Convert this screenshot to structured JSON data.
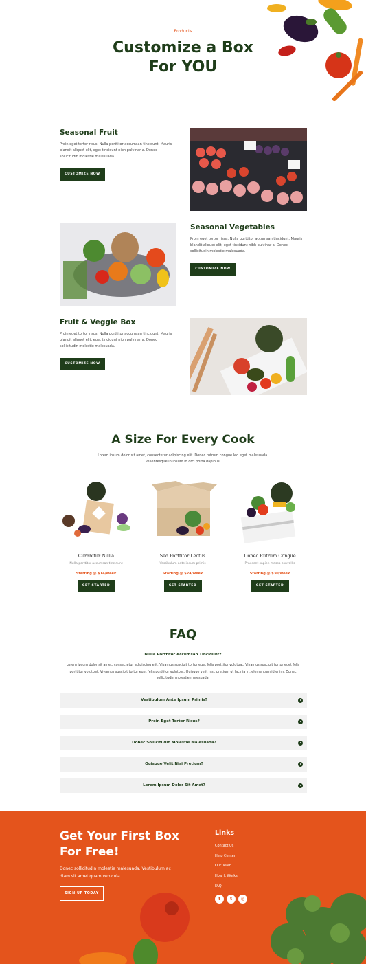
{
  "hero": {
    "eyebrow": "Products",
    "title": "Customize a Box For YOU"
  },
  "features": [
    {
      "title": "Seasonal Fruit",
      "body": "Proin eget tortor risus. Nulla porttitor accumsan tincidunt. Mauris blandit aliquet elit, eget tincidunt nibh pulvinar a. Donec sollicitudin molestie malesuada.",
      "button": "CUSTOMIZE NOW"
    },
    {
      "title": "Seasonal Vegetables",
      "body": "Proin eget tortor risus. Nulla porttitor accumsan tincidunt. Mauris blandit aliquet elit, eget tincidunt nibh pulvinar a. Donec sollicitudin molestie malesuada.",
      "button": "CUSTOMIZE NOW"
    },
    {
      "title": "Fruit & Veggie Box",
      "body": "Proin eget tortor risus. Nulla porttitor accumsan tincidunt. Mauris blandit aliquet elit, eget tincidunt nibh pulvinar a. Donec sollicitudin molestie malesuada.",
      "button": "CUSTOMIZE NOW"
    }
  ],
  "sizes": {
    "title": "A Size For Every Cook",
    "description": "Lorem ipsum dolor sit amet, consectetur adipiscing elit. Donec rutrum congue leo eget malesuada. Pellentesque in ipsum id orci porta dapibus.",
    "cards": [
      {
        "title": "Curabitur Nulla",
        "subtitle": "Nulla porttitor accumsan tincidunt",
        "price": "Starting @ $14/week",
        "button": "GET STARTED"
      },
      {
        "title": "Sed Porttitor Lectus",
        "subtitle": "Vestibulum ante ipsum primis",
        "price": "Starting @ $24/week",
        "button": "GET STARTED"
      },
      {
        "title": "Donec Rutrum Congue",
        "subtitle": "Praesent sapien massa convallis",
        "price": "Starting @ $30/week",
        "button": "GET STARTED"
      }
    ]
  },
  "faq": {
    "title": "FAQ",
    "open_question": "Nulla Porttitor Accumsan Tincidunt?",
    "open_answer": "Lorem ipsum dolor sit amet, consectetur adipiscing elit. Vivamus suscipit tortor eget felis porttitor volutpat. Vivamus suscipit tortor eget felis porttitor volutpat. Vivamus suscipit tortor eget felis porttitor volutpat. Quisque velit nisi, pretium ut lacinia in, elementum id enim. Donec sollicitudin molestie malesuada.",
    "items": [
      "Vestibulum Ante Ipsum Primis?",
      "Proin Eget Tortor Risus?",
      "Donec Sollicitudin Molestie Malesuada?",
      "Quisque Velit Nisi Pretium?",
      "Lorem Ipsum Dolor Sit Amet?"
    ]
  },
  "footer": {
    "title": "Get Your First Box For Free!",
    "text": "Donec sollicitudin molestie malesuada. Vestibulum ac diam sit amet quam vehicula.",
    "button": "SIGN UP TODAY",
    "links_heading": "Links",
    "links": [
      "Contact Us",
      "Help Center",
      "Our Team",
      "How It Works",
      "FAQ"
    ],
    "social": [
      {
        "icon": "facebook-icon",
        "glyph": "f"
      },
      {
        "icon": "twitter-icon",
        "glyph": "t"
      },
      {
        "icon": "instagram-icon",
        "glyph": "◎"
      }
    ]
  },
  "colors": {
    "brand_green": "#1f3d1a",
    "accent_orange": "#e4541c",
    "faq_bg": "#f1f1f1"
  }
}
